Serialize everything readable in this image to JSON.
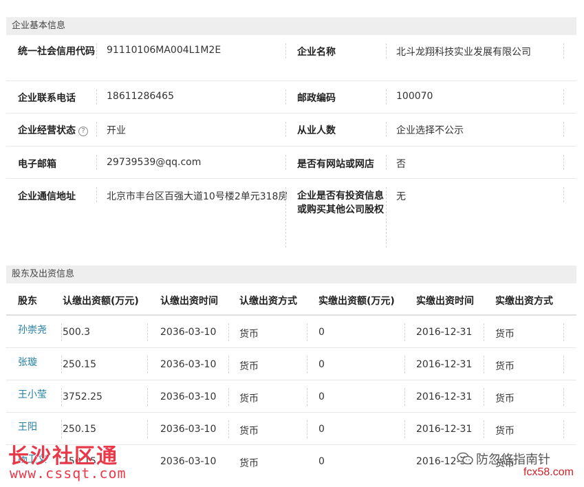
{
  "basic_info": {
    "title": "企业基本信息",
    "rows": [
      {
        "l1": "统一社会信用代码",
        "v1": "91110106MA004L1M2E",
        "l2": "企业名称",
        "v2": "北斗龙翔科技实业发展有限公司"
      },
      {
        "l1": "企业联系电话",
        "v1": "18611286465",
        "l2": "邮政编码",
        "v2": "100070"
      },
      {
        "l1": "企业经营状态",
        "v1": "开业",
        "l2": "从业人数",
        "v2": "企业选择不公示"
      },
      {
        "l1": "电子邮箱",
        "v1": "29739539@qq.com",
        "l2": "是否有网站或网店",
        "v2": "否"
      },
      {
        "l1": "企业通信地址",
        "v1": "北京市丰台区百强大道10号楼2单元318房",
        "l2a": "企业是否有投资信息",
        "l2b": "或购买其他公司股权",
        "v2": "无"
      }
    ],
    "help_glyph": "?"
  },
  "shareholders": {
    "title": "股东及出资信息",
    "headers": [
      "股东",
      "认缴出资额(万元)",
      "认缴出资时间",
      "认缴出资方式",
      "实缴出资额(万元)",
      "实缴出资时间",
      "实缴出资方式"
    ],
    "rows": [
      {
        "name": "孙崇尧",
        "sub_amt": "500.3",
        "sub_date": "2036-03-10",
        "sub_method": "货币",
        "paid_amt": "0",
        "paid_date": "2016-12-31",
        "paid_method": "货币"
      },
      {
        "name": "张璇",
        "sub_amt": "250.15",
        "sub_date": "2036-03-10",
        "sub_method": "货币",
        "paid_amt": "0",
        "paid_date": "2016-12-31",
        "paid_method": "货币"
      },
      {
        "name": "王小莹",
        "sub_amt": "3752.25",
        "sub_date": "2036-03-10",
        "sub_method": "货币",
        "paid_amt": "0",
        "paid_date": "2016-12-31",
        "paid_method": "货币"
      },
      {
        "name": "王阳",
        "sub_amt": "250.15",
        "sub_date": "2036-03-10",
        "sub_method": "货币",
        "paid_amt": "0",
        "paid_date": "2016-12-31",
        "paid_method": "货币"
      },
      {
        "name": "杨卫文",
        "sub_amt": "250.15",
        "sub_date": "2036-03-10",
        "sub_method": "货币",
        "paid_amt": "0",
        "paid_date": "2016-12-31",
        "paid_method": "货币"
      }
    ]
  },
  "watermarks": {
    "left_logo": "长沙社区通",
    "left_url": "www.cssqt.com",
    "right_logo": "防忽悠指南针",
    "right_url": "fcx58.com",
    "right_icon": "wechat-icon"
  }
}
